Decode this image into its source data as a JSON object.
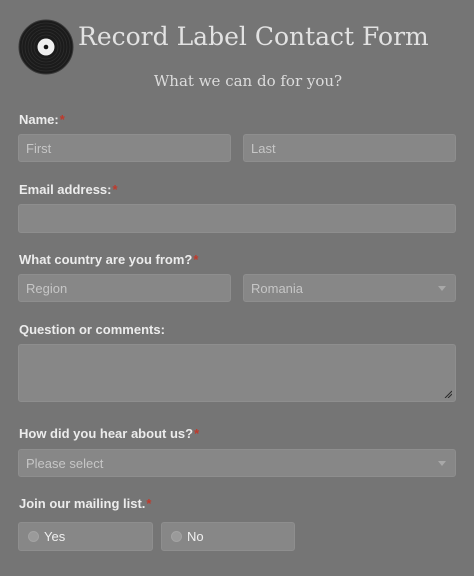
{
  "header": {
    "title": "Record Label Contact Form",
    "subtitle": "What we can do for you?",
    "logo_icon": "vinyl-record-icon"
  },
  "required_marker": "*",
  "form": {
    "name": {
      "label": "Name:",
      "first_placeholder": "First",
      "last_placeholder": "Last"
    },
    "email": {
      "label": "Email address:",
      "value": ""
    },
    "country": {
      "label": "What country are you from?",
      "region_placeholder": "Region",
      "country_selected": "Romania"
    },
    "comments": {
      "label": "Question or comments:",
      "value": ""
    },
    "referral": {
      "label": "How did you hear about us?",
      "selected": "Please select"
    },
    "mailing_list": {
      "label": "Join our mailing list.",
      "options": [
        "Yes",
        "No"
      ]
    }
  },
  "colors": {
    "background": "#757575",
    "field_background": "#878787",
    "required_marker": "#c0392b"
  }
}
